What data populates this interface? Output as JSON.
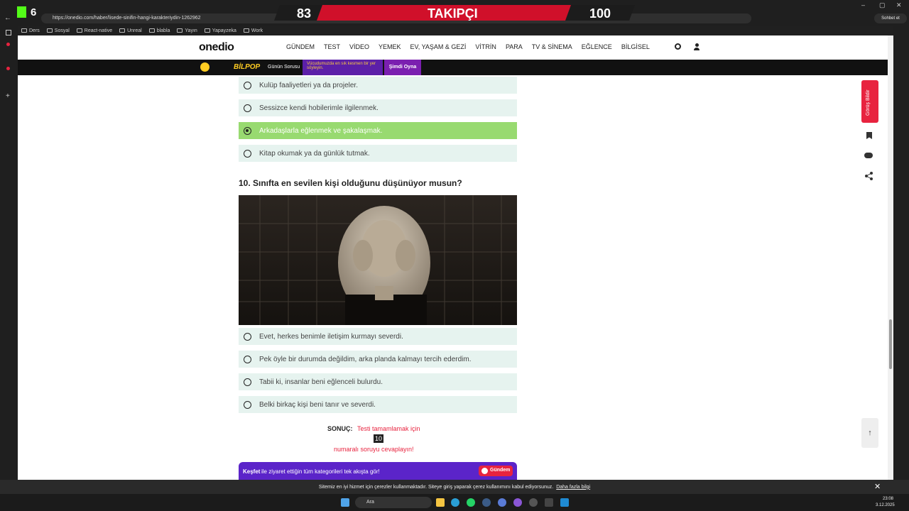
{
  "browser": {
    "url": "https://onedio.com/haber/lisede-sinifin-hangi-karakteriydin-1262962",
    "bookmarks": [
      "Ders",
      "Sosyal",
      "React-native",
      "Unreal",
      "blabla",
      "Yayın",
      "Yapayzeka",
      "Work"
    ],
    "profile_badge": "6",
    "chat_button": "Sohbet et"
  },
  "overlay": {
    "left_value": "83",
    "title": "TAKIPÇI",
    "right_value": "100"
  },
  "site": {
    "logo": "onedio",
    "nav": [
      "GÜNDEM",
      "TEST",
      "VİDEO",
      "YEMEK",
      "EV, YAŞAM & GEZİ",
      "VİTRİN",
      "PARA",
      "TV & SİNEMA",
      "EĞLENCE",
      "BİLGİSEL"
    ]
  },
  "ad": {
    "brand": "BİLPOP",
    "label": "Günün Sorusu",
    "prompt": "Vücudumuzda en sık kesmen bir yer söyleyin.",
    "cta": "Şimdi Oyna"
  },
  "q9_options": [
    {
      "text": "Kulüp faaliyetleri ya da projeler.",
      "selected": false
    },
    {
      "text": "Sessizce kendi hobilerimle ilgilenmek.",
      "selected": false
    },
    {
      "text": "Arkadaşlarla eğlenmek ve şakalaşmak.",
      "selected": true
    },
    {
      "text": "Kitap okumak ya da günlük tutmak.",
      "selected": false
    }
  ],
  "question10": {
    "title": "10. Sınıfta en sevilen kişi olduğunu düşünüyor musun?",
    "options": [
      "Evet, herkes benimle iletişim kurmayı severdi.",
      "Pek öyle bir durumda değildim, arka planda kalmayı tercih ederdim.",
      "Tabii ki, insanlar beni eğlenceli bulurdu.",
      "Belki birkaç kişi beni tanır ve severdi."
    ]
  },
  "result": {
    "label": "SONUÇ:",
    "line1": "Testi tamamlamak için",
    "number": "10",
    "line2": "numaralı soruyu cevaplayın!"
  },
  "explore": {
    "bold": "Keşfet",
    "text": "ile ziyaret ettiğin tüm kategorileri tek akışta gör!",
    "button": "Gündem"
  },
  "feedback_button": "Görüş Bildir",
  "cookie": {
    "text": "Sitemiz en iyi hizmet için çerezler kullanmaktadır. Siteye giriş yaparak çerez kullanımını kabul ediyorsunuz.",
    "link": "Daha fazla bilgi"
  },
  "taskbar": {
    "search": "Ara",
    "time": "23:08",
    "date": "3.12.2025"
  },
  "colors": {
    "accent": "#e8233f",
    "selected": "#98da70",
    "option_bg": "#e6f3ef",
    "explore_bg": "#5b24c9"
  }
}
